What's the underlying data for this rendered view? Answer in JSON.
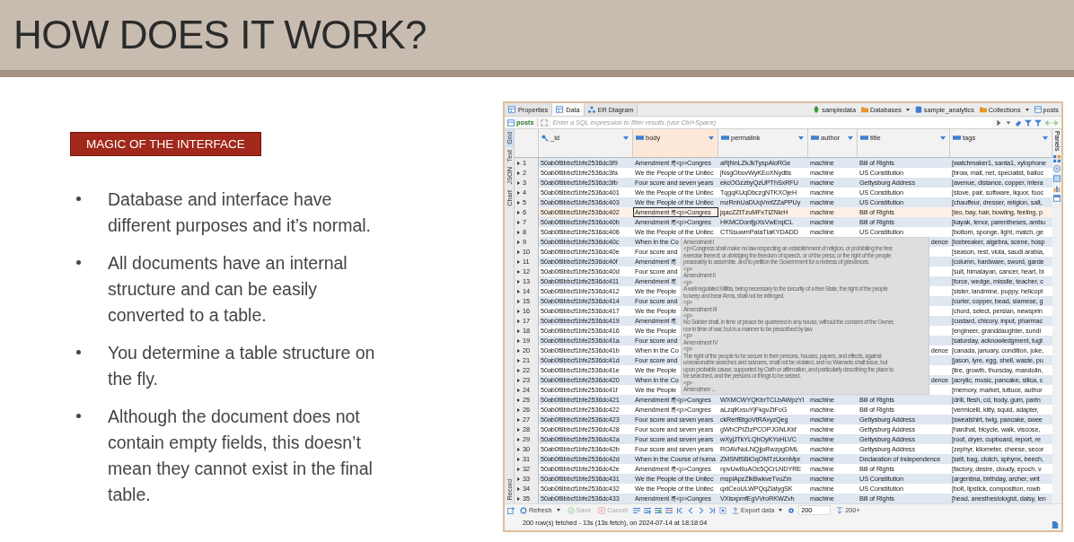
{
  "slide": {
    "title": "HOW DOES IT WORK?",
    "tag": "MAGIC OF THE INTERFACE",
    "bullets": [
      "Database and interface have different purposes and it’s normal.",
      "All documents have an internal structure and can be easily converted to a table.",
      "You determine a table structure on the fly.",
      "Although the document does not contain empty fields, this doesn’t mean they cannot exist in the final table."
    ]
  },
  "app": {
    "tabs": [
      {
        "label": "Properties",
        "selected": false
      },
      {
        "label": "Data",
        "selected": true
      },
      {
        "label": "ER Diagram",
        "selected": false
      }
    ],
    "breadcrumbs": [
      {
        "label": "sampledata",
        "kind": "connection"
      },
      {
        "label": "Databases",
        "kind": "folder",
        "dropdown": true
      },
      {
        "label": "sample_analytics",
        "kind": "database"
      },
      {
        "label": "Collections",
        "kind": "collections",
        "dropdown": true
      },
      {
        "label": "posts",
        "kind": "table"
      }
    ],
    "filter": {
      "source": "posts",
      "placeholder": "Enter a SQL expression to filter results (use Ctrl+Space)"
    },
    "view_tabs": [
      {
        "label": "Grid",
        "selected": true
      },
      {
        "label": "Text",
        "selected": false
      },
      {
        "label": "JSON",
        "selected": false
      },
      {
        "label": "Chart",
        "selected": false
      }
    ],
    "record_tab": "Record",
    "panels_tab": "Panels",
    "columns": [
      {
        "name": "_id",
        "kind": "key",
        "selected": false
      },
      {
        "name": "body",
        "kind": "text",
        "selected": true
      },
      {
        "name": "permalink",
        "kind": "text",
        "selected": false
      },
      {
        "name": "author",
        "kind": "text",
        "selected": false
      },
      {
        "name": "title",
        "kind": "text",
        "selected": false
      },
      {
        "name": "tags",
        "kind": "text",
        "selected": false
      }
    ],
    "rows": [
      {
        "num": "1",
        "kind": "full",
        "selected": false,
        "id": "50ab0f8bbcf1bfe2536dc3f9",
        "body": "Amendment I¶<p>Congres",
        "permalink": "aRjNnLZkJkTyspAloRGe",
        "author": "machine",
        "title": "Bill of Rights",
        "tags": "[watchmaker1, santa1, xylophone"
      },
      {
        "num": "2",
        "kind": "full",
        "selected": false,
        "id": "50ab0f8bbcf1bfe2536dc3fa",
        "body": "We the People of the Unitec",
        "permalink": "jNsgObovWyKEoXNydtis",
        "author": "machine",
        "title": "US Constitution",
        "tags": "[brow, mall, net, specialist, balloc"
      },
      {
        "num": "3",
        "kind": "full",
        "selected": false,
        "id": "50ab0f8bbcf1bfe2536dc3fb",
        "body": "Four score and seven years",
        "permalink": "ekcOGzzbyQzUPThSxRFU",
        "author": "machine",
        "title": "Gettysburg Address",
        "tags": "[avenue, distance, copper, intera"
      },
      {
        "num": "4",
        "kind": "full",
        "selected": false,
        "id": "50ab0f8bbcf1bfe2536dc401",
        "body": "We the People of the Unitec",
        "permalink": "TqgqKUqDbczgNTKXOjeH",
        "author": "machine",
        "title": "US Constitution",
        "tags": "[stove, pair, software, liquor, fooc"
      },
      {
        "num": "5",
        "kind": "full",
        "selected": false,
        "id": "50ab0f8bbcf1bfe2536dc403",
        "body": "We the People of the Unitec",
        "permalink": "mzRnhUaDUqVmfZZaPPUy",
        "author": "machine",
        "title": "US Constitution",
        "tags": "[chauffeur, dresser, religion, salt,"
      },
      {
        "num": "6",
        "kind": "full",
        "selected": true,
        "id": "50ab0f8bbcf1bfe2536dc402",
        "body": "Amendment I¶<p>Congres",
        "permalink": "jqacZZtTzuMFxTlZNkrH",
        "author": "machine",
        "title": "Bill of Rights",
        "tags": "[leo, bay, hair, bowling, feeling, p"
      },
      {
        "num": "7",
        "kind": "full",
        "selected": false,
        "id": "50ab0f8bbcf1bfe2536dc40b",
        "body": "Amendment I¶<p>Congres",
        "permalink": "HKMCDonfjpXsVwErqiCL",
        "author": "machine",
        "title": "Bill of Rights",
        "tags": "[kayak, tenor, parentheses, ambu"
      },
      {
        "num": "8",
        "kind": "full",
        "selected": false,
        "id": "50ab0f8bbcf1bfe2536dc406",
        "body": "We the People of the Unitec",
        "permalink": "CTSsuwmPataTlaKYDADD",
        "author": "machine",
        "title": "US Constitution",
        "tags": "[bottom, sponge, light, match, ge"
      },
      {
        "num": "9",
        "kind": "covered",
        "selected": false,
        "id": "50ab0f8bbcf1bfe2536dc40c",
        "body": "When in the Co",
        "title": "dence",
        "tags": "[icebreaker, algebra, scene, hosp"
      },
      {
        "num": "10",
        "kind": "covered",
        "selected": false,
        "id": "50ab0f8bbcf1bfe2536dc40e",
        "body": "Four score and",
        "tags": "[season, rest, viola, saudi arabia,"
      },
      {
        "num": "11",
        "kind": "covered",
        "selected": false,
        "id": "50ab0f8bbcf1bfe2536dc40f",
        "body": "Amendment I¶",
        "tags": "[column, hardware, sword, garde"
      },
      {
        "num": "12",
        "kind": "covered",
        "selected": false,
        "id": "50ab0f8bbcf1bfe2536dc40d",
        "body": "Four score and",
        "tags": "[suit, himalayan, cancer, heart, bi"
      },
      {
        "num": "13",
        "kind": "covered",
        "selected": false,
        "id": "50ab0f8bbcf1bfe2536dc411",
        "body": "Amendment I¶",
        "tags": "[force, wedge, missile, teacher, c"
      },
      {
        "num": "14",
        "kind": "covered",
        "selected": false,
        "id": "50ab0f8bbcf1bfe2536dc412",
        "body": "We the People",
        "tags": "[sister, landmine, puppy, helicopt"
      },
      {
        "num": "15",
        "kind": "covered",
        "selected": false,
        "id": "50ab0f8bbcf1bfe2536dc414",
        "body": "Four score and",
        "tags": "[curler, copper, bead, siamese, g"
      },
      {
        "num": "16",
        "kind": "covered",
        "selected": false,
        "id": "50ab0f8bbcf1bfe2536dc417",
        "body": "We the People",
        "tags": "[chord, select, persian, newsprin"
      },
      {
        "num": "17",
        "kind": "covered",
        "selected": false,
        "id": "50ab0f8bbcf1bfe2536dc419",
        "body": "Amendment I¶",
        "tags": "[custard, chicory, input, pharmac"
      },
      {
        "num": "18",
        "kind": "covered",
        "selected": false,
        "id": "50ab0f8bbcf1bfe2536dc416",
        "body": "We the People",
        "tags": "[engineer, granddaughter, sundi"
      },
      {
        "num": "19",
        "kind": "covered",
        "selected": false,
        "id": "50ab0f8bbcf1bfe2536dc41a",
        "body": "Four score and",
        "tags": "[saturday, acknowledgment, tugt"
      },
      {
        "num": "20",
        "kind": "covered",
        "selected": false,
        "id": "50ab0f8bbcf1bfe2536dc41b",
        "body": "When in the Co",
        "title": "dence",
        "tags": "[canada, january, condition, joke,"
      },
      {
        "num": "21",
        "kind": "covered",
        "selected": false,
        "id": "50ab0f8bbcf1bfe2536dc41d",
        "body": "Four score and",
        "tags": "[jason, lyre, egg, shell, waste, pu"
      },
      {
        "num": "22",
        "kind": "covered",
        "selected": false,
        "id": "50ab0f8bbcf1bfe2536dc41e",
        "body": "We the People",
        "tags": "[tire, growth, thursday, mandolin,"
      },
      {
        "num": "23",
        "kind": "covered",
        "selected": false,
        "id": "50ab0f8bbcf1bfe2536dc420",
        "body": "When in the Co",
        "title": "dence",
        "tags": "[acrylic, music, pancake, silica, c"
      },
      {
        "num": "24",
        "kind": "covered",
        "selected": false,
        "id": "50ab0f8bbcf1bfe2536dc41f",
        "body": "We the People",
        "tags": "[memory, market, luttuce, author"
      },
      {
        "num": "25",
        "kind": "full",
        "selected": false,
        "id": "50ab0f8bbcf1bfe2536dc421",
        "body": "Amendment I¶<p>Congres",
        "permalink": "WXMCWYQKbrTCLbAWpzYI",
        "author": "machine",
        "title": "Bill of Rights",
        "tags": "[drill, flesh, cd, body, gum, partn"
      },
      {
        "num": "26",
        "kind": "full",
        "selected": false,
        "id": "50ab0f8bbcf1bfe2536dc422",
        "body": "Amendment I¶<p>Congres",
        "permalink": "aLzqlKxsuYjFkgvZtFoG",
        "author": "machine",
        "title": "Bill of Rights",
        "tags": "[vermicelli, kitty, squid, adapter,"
      },
      {
        "num": "27",
        "kind": "full",
        "selected": false,
        "id": "50ab0f8bbcf1bfe2536dc423",
        "body": "Four score and seven years",
        "permalink": "ckRerfBtgoVtRAxyzQeg",
        "author": "machine",
        "title": "Gettysburg Address",
        "tags": "[sweatshirt, twig, pancake, swee"
      },
      {
        "num": "28",
        "kind": "full",
        "selected": false,
        "id": "50ab0f8bbcf1bfe2536dc428",
        "body": "Four score and seven years",
        "permalink": "gWhCPIZIzPCOPJGNLKkf",
        "author": "machine",
        "title": "Gettysburg Address",
        "tags": "[hardhat, bicycle, walk, viscose,"
      },
      {
        "num": "29",
        "kind": "full",
        "selected": false,
        "id": "50ab0f8bbcf1bfe2536dc42a",
        "body": "Four score and seven years",
        "permalink": "wXyjJTkYLQhOyKYoHLVC",
        "author": "machine",
        "title": "Gettysburg Address",
        "tags": "[roof, dryer, cupboard, report, re"
      },
      {
        "num": "30",
        "kind": "full",
        "selected": false,
        "id": "50ab0f8bbcf1bfe2536dc42b",
        "body": "Four score and seven years",
        "permalink": "ROAVNoLNQjjoRwzpgDML",
        "author": "machine",
        "title": "Gettysburg Address",
        "tags": "[zephyr, kilometer, cheese, secor"
      },
      {
        "num": "31",
        "kind": "full",
        "selected": false,
        "id": "50ab0f8bbcf1bfe2536dc42d",
        "body": "When in the Course of huma",
        "permalink": "ZMSNfSBiOqOMTzUomMpr",
        "author": "machine",
        "title": "Declaration of Independence",
        "tags": "[self, bag, clutch, sphynx, beech,"
      },
      {
        "num": "32",
        "kind": "full",
        "selected": false,
        "id": "50ab0f8bbcf1bfe2536dc42e",
        "body": "Amendment I¶<p>Congres",
        "permalink": "npvUwBuAOc5QCrLNDYRE",
        "author": "machine",
        "title": "Bill of Rights",
        "tags": "[factory, desire, cloudy, epoch, v"
      },
      {
        "num": "33",
        "kind": "full",
        "selected": false,
        "id": "50ab0f8bbcf1bfe2536dc431",
        "body": "We the People of the Unitec",
        "permalink": "mspiApzZlkBwkveTvuZm",
        "author": "machine",
        "title": "US Constitution",
        "tags": "[argentina, birthday, archer, writ"
      },
      {
        "num": "34",
        "kind": "full",
        "selected": false,
        "id": "50ab0f8bbcf1bfe2536dc432",
        "body": "We the People of the Unitec",
        "permalink": "qxtCeoULWPQqZiatygSK",
        "author": "machine",
        "title": "US Constitution",
        "tags": "[bolt, lipstick, composition, rowb"
      },
      {
        "num": "35",
        "kind": "full",
        "selected": false,
        "id": "50ab0f8bbcf1bfe2536dc433",
        "body": "Amendment I¶<p>Congres",
        "permalink": "VXisxpmfEgVVroRKWZvh",
        "author": "machine",
        "title": "Bill of Rights",
        "tags": "[head, anesthesiologist, daisy, len"
      }
    ],
    "tooltip": [
      "Amendment I",
      "<p>Congress shall make no law respecting an establishment of religion, or prohibiting the free",
      "exercise thereof; or abridging the freedom of speech, or of the press; or the right of the people",
      "peaceably to assemble, and to petition the Government for a redress of grievances.",
      "<p>",
      "Amendment II",
      "<p>",
      "A well regulated Militia, being necessary to the security of a free State, the right of the people",
      "to keep and bear Arms, shall not be infringed.",
      "<p>",
      "Amendment III",
      "<p>",
      "No Soldier shall, in time of peace be quartered in any house, without the consent of the Owner,",
      "nor in time of war, but in a manner to be prescribed by law.",
      "<p>",
      "Amendment IV",
      "<p>",
      "The right of the people to be secure in their persons, houses, papers, and effects, against",
      "unreasonable searches and seizures, shall not be violated, and no Warrants shall issue, but",
      "upon probable cause, supported by Oath or affirmation, and particularly describing the place to",
      "be searched, and the persons or things to be seized.",
      "<p>",
      "Amendmen ..."
    ],
    "toolbar": {
      "refresh": "Refresh",
      "save": {
        "label": "Save",
        "disabled": true
      },
      "cancel": {
        "label": "Cancel",
        "disabled": true
      },
      "export": "Export data",
      "fetch_size": "200",
      "fetch_all": "200+"
    },
    "status": "200 row(s) fetched - 13s (13s fetch), on 2024-07-14 at 18:18:04"
  }
}
